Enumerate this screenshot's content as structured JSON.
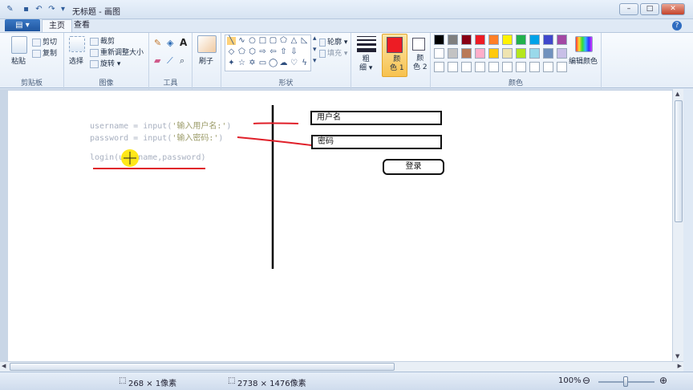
{
  "window": {
    "title": "无标题 - 画图",
    "controls": {
      "minimize": "–",
      "maximize": "□",
      "close": "✕"
    }
  },
  "tabs": {
    "file": "▤ ▾",
    "home": "主页",
    "view": "查看"
  },
  "ribbon": {
    "clipboard": {
      "paste": "粘贴",
      "cut": "剪切",
      "copy": "复制",
      "label": "剪贴板"
    },
    "image": {
      "select": "选择",
      "crop": "裁剪",
      "resize": "重新调整大小",
      "rotate": "旋转 ▾",
      "label": "图像"
    },
    "tools": {
      "label": "工具"
    },
    "brushes": {
      "label": "刷子"
    },
    "shapes": {
      "outline": "轮廓 ▾",
      "fill": "填充 ▾",
      "label": "形状"
    },
    "size": {
      "label": "粗\n细 ▾"
    },
    "color1": {
      "label": "颜\n色 1"
    },
    "color2": {
      "label": "颜\n色 2"
    },
    "colors": {
      "label": "颜色",
      "edit": "编辑颜色"
    },
    "palette_row1": [
      "#000000",
      "#7f7f7f",
      "#880015",
      "#ed1c24",
      "#ff7f27",
      "#fff200",
      "#22b14c",
      "#00a2e8",
      "#3f48cc",
      "#a349a4"
    ],
    "palette_row2": [
      "#ffffff",
      "#c3c3c3",
      "#b97a57",
      "#ffaec9",
      "#ffc90e",
      "#efe4b0",
      "#b5e61d",
      "#99d9ea",
      "#7092be",
      "#c8bfe7"
    ],
    "primary_color": "#ed1c24",
    "secondary_color": "#ffffff"
  },
  "canvas": {
    "code_line1": "username = input(",
    "code_line1_str": "'输入用户名:'",
    "code_line1_end": ")",
    "code_line2": "password = input(",
    "code_line2_str": "'输入密码:'",
    "code_line2_end": ")",
    "code_line3": "login(username,password)",
    "box_username": "用户名",
    "box_password": "密码",
    "button_login": "登录"
  },
  "statusbar": {
    "selection_size": "268 × 1像素",
    "image_size": "2738 × 1476像素",
    "zoom": "100%"
  }
}
